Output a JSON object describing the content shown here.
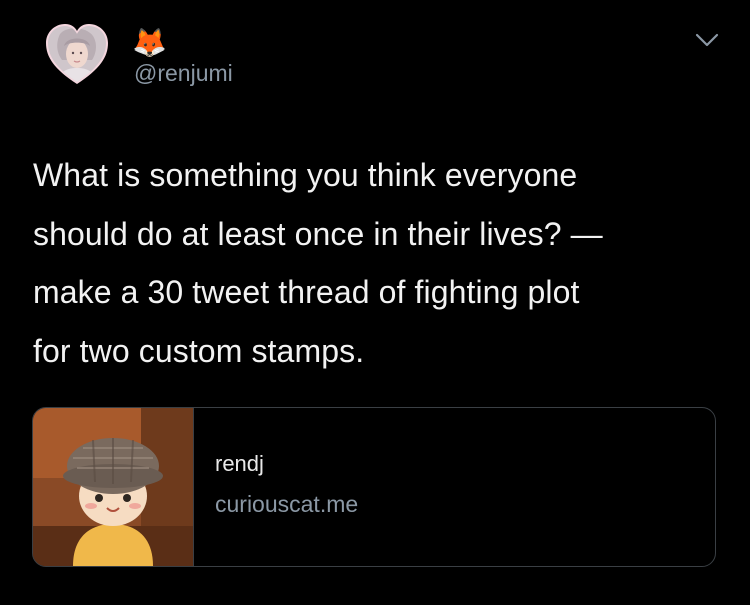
{
  "tweet": {
    "display_name": "🦊",
    "handle": "@renjumi",
    "text": "What is something you think everyone\nshould do at least once in their lives? —\nmake a 30 tweet thread of fighting plot\nfor two custom stamps.",
    "menu_icon": "chevron-down-icon"
  },
  "card": {
    "title": "rendj",
    "domain": "curiouscat.me"
  },
  "colors": {
    "background": "#000000",
    "text": "#f2f2f2",
    "secondary_text": "#8b98a5",
    "card_border": "#3a3f44"
  }
}
